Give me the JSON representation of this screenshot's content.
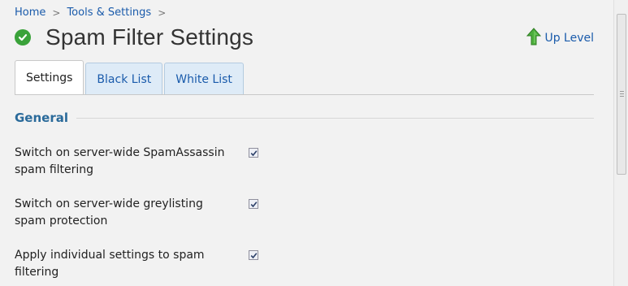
{
  "breadcrumb": {
    "items": [
      "Home",
      "Tools & Settings"
    ],
    "separator": ">"
  },
  "header": {
    "title": "Spam Filter Settings",
    "status_icon": "check-circle-icon",
    "up_level_label": "Up Level",
    "up_level_icon": "up-arrow-icon"
  },
  "tabs": [
    {
      "label": "Settings",
      "active": true
    },
    {
      "label": "Black List",
      "active": false
    },
    {
      "label": "White List",
      "active": false
    }
  ],
  "section": {
    "title": "General"
  },
  "settings": [
    {
      "label": "Switch on server-wide SpamAssassin spam filtering",
      "checked": true
    },
    {
      "label": "Switch on server-wide greylisting spam protection",
      "checked": true
    },
    {
      "label": "Apply individual settings to spam filtering",
      "checked": true
    }
  ],
  "colors": {
    "link": "#1a5bab",
    "section_title": "#2a6a9a",
    "status_green": "#3aa23a",
    "background": "#f2f2f2"
  }
}
